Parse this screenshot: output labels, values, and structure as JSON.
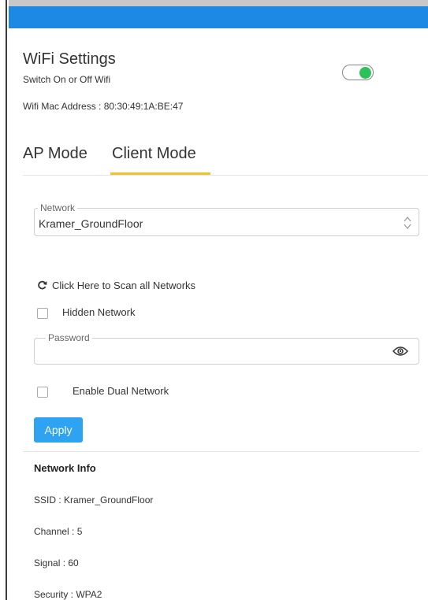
{
  "header": {
    "color": "#1e88e5"
  },
  "settings": {
    "title": "WiFi Settings",
    "subtitle": "Switch On or Off Wifi",
    "wifi_on": true,
    "mac_label": "Wifi Mac Address : 80:30:49:1A:BE:47"
  },
  "tabs": [
    {
      "label": "AP Mode",
      "active": false
    },
    {
      "label": "Client Mode",
      "active": true
    }
  ],
  "form": {
    "network": {
      "legend": "Network",
      "value": "Kramer_GroundFloor"
    },
    "scan_label": "Click Here to Scan all Networks",
    "hidden_network_label": "Hidden Network",
    "hidden_network_checked": false,
    "password": {
      "legend": "Password",
      "value": ""
    },
    "dual_network_label": "Enable Dual Network",
    "dual_network_checked": false,
    "apply_label": "Apply"
  },
  "network_info": {
    "heading": "Network Info",
    "ssid": "SSID : Kramer_GroundFloor",
    "channel": "Channel : 5",
    "signal": "Signal : 60",
    "security": "Security : WPA2"
  },
  "colors": {
    "accent": "#f2c12e",
    "toggle_on": "#2ec05a",
    "button": "#2ea3f2"
  },
  "icons": {
    "scan": "refresh-icon",
    "password_toggle": "eye-icon",
    "select": "updown-chevron-icon"
  }
}
